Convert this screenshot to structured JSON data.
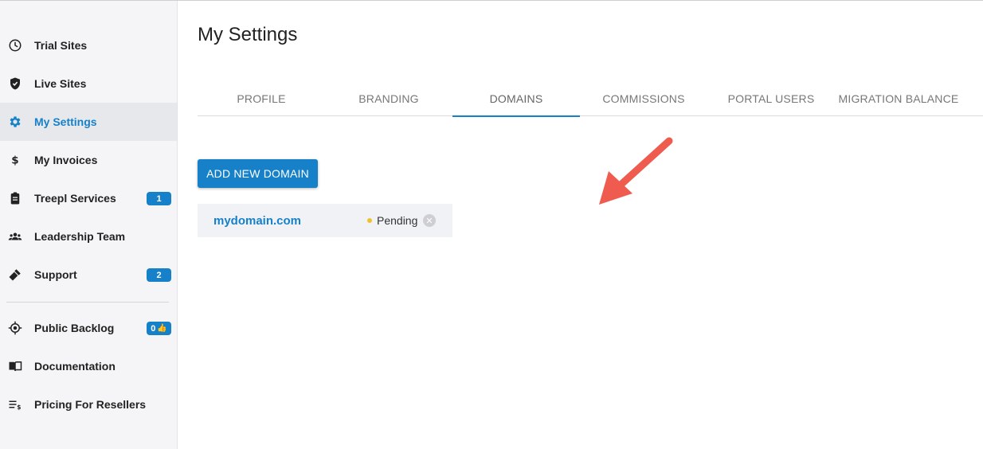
{
  "sidebar": {
    "items": [
      {
        "label": "Trial Sites",
        "icon": "clock-icon"
      },
      {
        "label": "Live Sites",
        "icon": "shield-check-icon"
      },
      {
        "label": "My Settings",
        "icon": "gear-icon",
        "active": true
      },
      {
        "label": "My Invoices",
        "icon": "dollar-icon"
      },
      {
        "label": "Treepl Services",
        "icon": "clipboard-icon",
        "badge": "1"
      },
      {
        "label": "Leadership Team",
        "icon": "group-icon"
      },
      {
        "label": "Support",
        "icon": "tools-icon",
        "badge": "2"
      }
    ],
    "secondary": [
      {
        "label": "Public Backlog",
        "icon": "target-icon",
        "badge": "0"
      },
      {
        "label": "Documentation",
        "icon": "book-icon"
      },
      {
        "label": "Pricing For Resellers",
        "icon": "price-list-icon"
      }
    ]
  },
  "main": {
    "title": "My Settings",
    "tabs": [
      "PROFILE",
      "BRANDING",
      "DOMAINS",
      "COMMISSIONS",
      "PORTAL USERS",
      "MIGRATION BALANCE"
    ],
    "active_tab": "DOMAINS",
    "add_button": "ADD NEW DOMAIN",
    "domains": [
      {
        "name": "mydomain.com",
        "status": "Pending"
      }
    ]
  },
  "colors": {
    "accent": "#1680c8",
    "pending_dot": "#f0c030",
    "arrow": "#f05b4f"
  }
}
